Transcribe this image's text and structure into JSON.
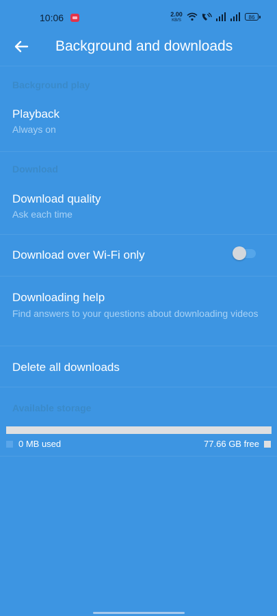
{
  "status_bar": {
    "time": "10:06",
    "net_speed_value": "2.00",
    "net_speed_unit": "KB/S",
    "battery": "86",
    "icons": [
      "screen-record-icon",
      "wifi-icon",
      "volte-call-icon",
      "signal-icon",
      "signal-icon",
      "battery-icon"
    ]
  },
  "app_bar": {
    "back_icon": "arrow-left-icon",
    "title": "Background and downloads"
  },
  "sections": {
    "background_play": "Background play",
    "download": "Download",
    "available_storage": "Available storage"
  },
  "playback": {
    "title": "Playback",
    "subtitle": "Always on"
  },
  "download_quality": {
    "title": "Download quality",
    "subtitle": "Ask each time"
  },
  "wifi_only": {
    "title": "Download over Wi-Fi only",
    "enabled": false
  },
  "downloading_help": {
    "title": "Downloading help",
    "subtitle": "Find answers to your questions about downloading videos"
  },
  "delete_all": {
    "title": "Delete all downloads"
  },
  "storage": {
    "used_label": "0 MB used",
    "free_label": "77.66 GB free",
    "used_fraction": 0,
    "used_color": "#5aa6ea",
    "free_color": "#dedfe1"
  },
  "colors": {
    "background": "#3d95e2",
    "section_header": "#3a8ac9",
    "subtitle": "#a9d2f5"
  }
}
